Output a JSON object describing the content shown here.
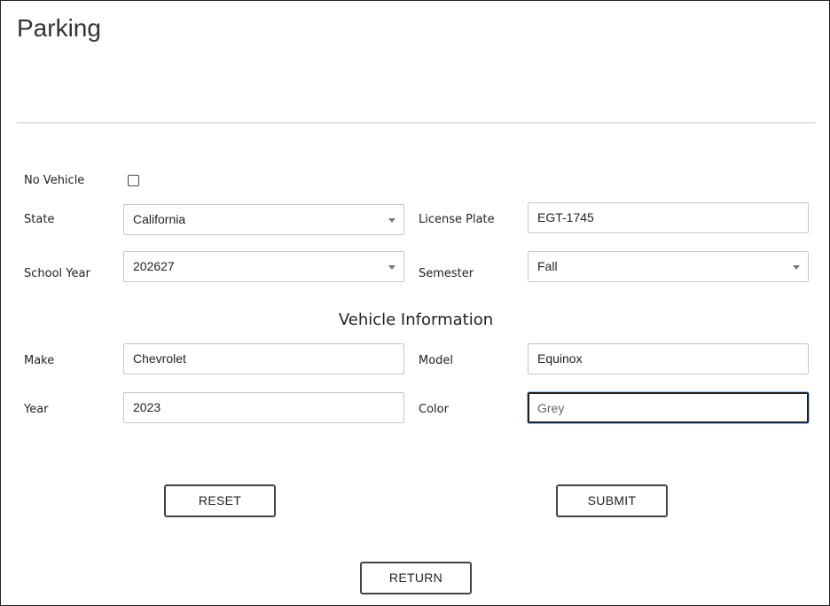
{
  "page": {
    "title": "Parking"
  },
  "labels": {
    "no_vehicle": "No Vehicle",
    "state": "State",
    "license_plate": "License Plate",
    "school_year": "School Year",
    "semester": "Semester",
    "make": "Make",
    "model": "Model",
    "year": "Year",
    "color": "Color"
  },
  "values": {
    "no_vehicle_checked": false,
    "state": "California",
    "license_plate": "EGT-1745",
    "school_year": "202627",
    "semester": "Fall",
    "make": "Chevrolet",
    "model": "Equinox",
    "year": "2023",
    "color": "Grey"
  },
  "section": {
    "vehicle_info": "Vehicle Information"
  },
  "buttons": {
    "reset": "RESET",
    "submit": "SUBMIT",
    "return": "RETURN"
  },
  "icons": {
    "dropdown": "chevron-down-icon",
    "checkbox": "checkbox-icon"
  }
}
